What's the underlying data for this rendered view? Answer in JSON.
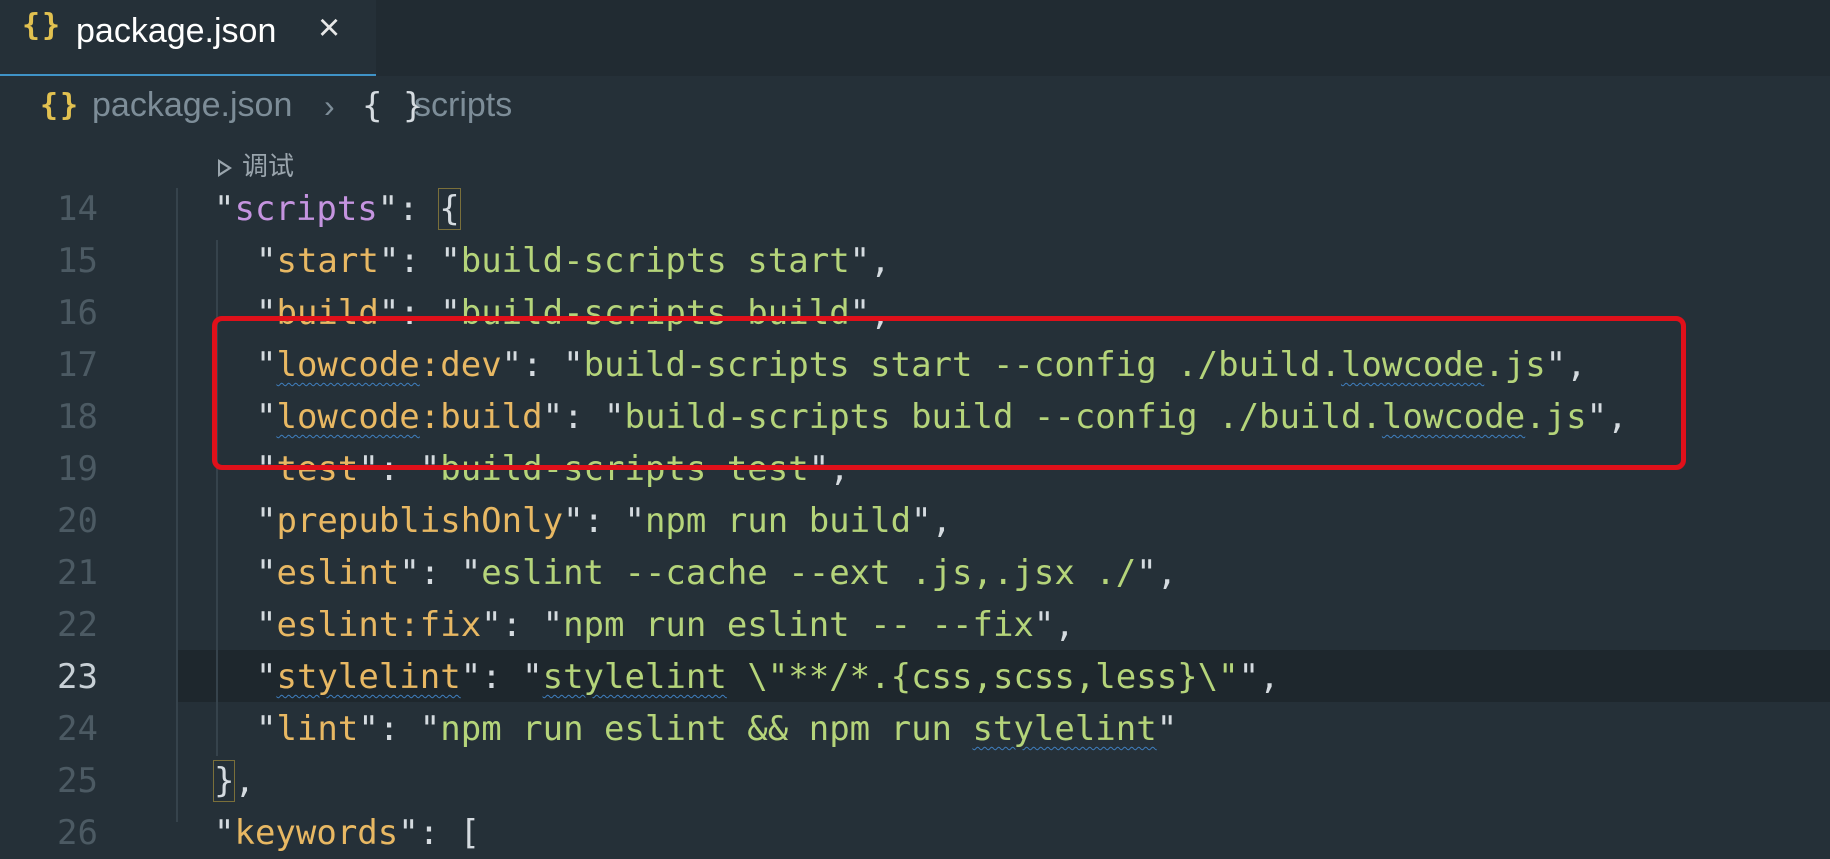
{
  "tab": {
    "icon": "{}",
    "title": "package.json",
    "close_icon": "×"
  },
  "breadcrumb": {
    "file_icon": "{}",
    "file": "package.json",
    "separator": "›",
    "symbol_icon": "{ }",
    "symbol": "scripts"
  },
  "codelens": {
    "label": "调试"
  },
  "lines": [
    {
      "num": "14",
      "key": "scripts",
      "value": null
    },
    {
      "num": "15",
      "key": "start",
      "value": "build-scripts start"
    },
    {
      "num": "16",
      "key": "build",
      "value": "build-scripts build"
    },
    {
      "num": "17",
      "key": "lowcode:dev",
      "value": "build-scripts start --config ./build.lowcode.js"
    },
    {
      "num": "18",
      "key": "lowcode:build",
      "value": "build-scripts build --config ./build.lowcode.js"
    },
    {
      "num": "19",
      "key": "test",
      "value": "build-scripts test"
    },
    {
      "num": "20",
      "key": "prepublishOnly",
      "value": "npm run build"
    },
    {
      "num": "21",
      "key": "eslint",
      "value": "eslint --cache --ext .js,.jsx ./"
    },
    {
      "num": "22",
      "key": "eslint:fix",
      "value": "npm run eslint -- --fix"
    },
    {
      "num": "23",
      "key": "stylelint",
      "value": "stylelint \\\"**/*.{css,scss,less}\\\""
    },
    {
      "num": "24",
      "key": "lint",
      "value": "npm run eslint && npm run stylelint"
    },
    {
      "num": "25",
      "key": null,
      "value": "},"
    },
    {
      "num": "26",
      "key": "keywords",
      "value": "["
    }
  ],
  "colors": {
    "editor_bg": "#253038",
    "key": "#e8b863",
    "string": "#b5d47a",
    "highlight_box": "#e0101a"
  }
}
